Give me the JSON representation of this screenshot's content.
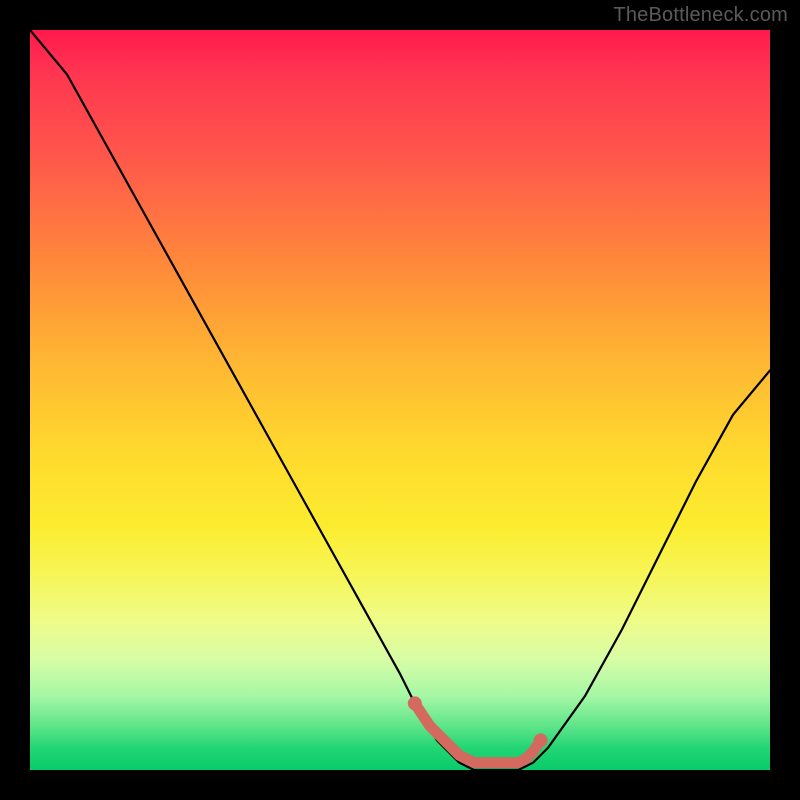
{
  "watermark": "TheBottleneck.com",
  "colors": {
    "curve": "#000000",
    "marker": "#d46a5f",
    "frame": "#000000"
  },
  "chart_data": {
    "type": "line",
    "title": "",
    "xlabel": "",
    "ylabel": "",
    "xlim": [
      0,
      100
    ],
    "ylim": [
      0,
      100
    ],
    "grid": false,
    "legend": false,
    "series": [
      {
        "name": "bottleneck-curve",
        "x": [
          0,
          5,
          10,
          15,
          20,
          25,
          30,
          35,
          40,
          45,
          50,
          52,
          55,
          58,
          60,
          63,
          66,
          68,
          70,
          75,
          80,
          85,
          90,
          95,
          100
        ],
        "y": [
          100,
          94,
          85,
          76,
          67,
          58,
          49,
          40,
          31,
          22,
          13,
          9,
          4,
          1,
          0,
          0,
          0,
          1,
          3,
          10,
          19,
          29,
          39,
          48,
          54
        ]
      }
    ],
    "annotations": [
      {
        "name": "optimal-band",
        "type": "marker-run",
        "x": [
          52,
          54,
          56,
          58,
          60,
          62,
          64,
          66,
          67,
          68,
          69
        ],
        "y": [
          9,
          6,
          4,
          2,
          1,
          1,
          1,
          1,
          1.5,
          2.5,
          4
        ]
      }
    ]
  }
}
